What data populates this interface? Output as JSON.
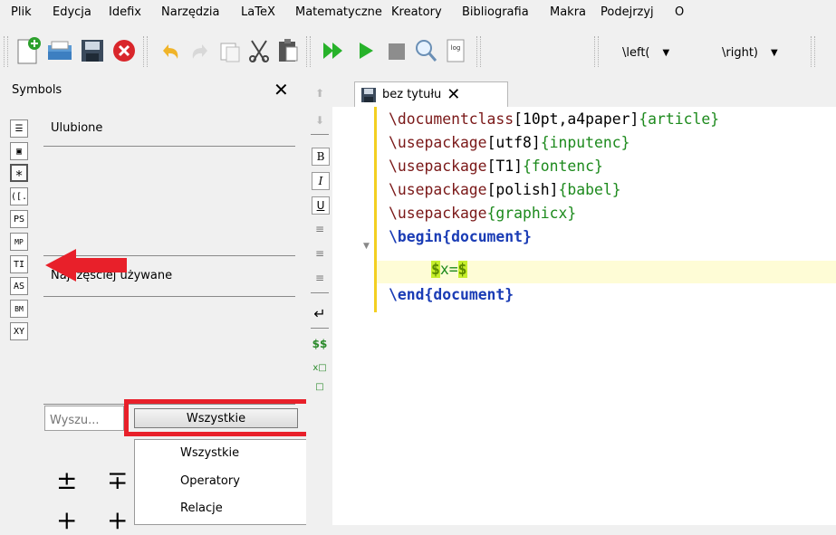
{
  "menubar": {
    "items": [
      "Plik",
      "Edycja",
      "Idefix",
      "Narzędzia",
      "LaTeX",
      "Matematyczne",
      "Kreatory",
      "Bibliografia",
      "Makra",
      "Podejrzyj",
      "O"
    ]
  },
  "toolbar": {
    "left_paren": "\\left(",
    "right_paren": "\\right)",
    "log_label": "log"
  },
  "symbols_panel": {
    "title": "Symbols",
    "close": "✕",
    "favorites_label": "Ulubione",
    "most_used_label": "Najczęściej używane",
    "side_icons": [
      "☰",
      "▣",
      "∗",
      "([.",
      "PS",
      "MP",
      "TI",
      "AS",
      "BM",
      "XY"
    ],
    "search_placeholder": "Wyszu...",
    "category_selected": "Wszystkie",
    "category_options": [
      "Wszystkie",
      "Operatory",
      "Relacje"
    ],
    "glyphs": [
      "±",
      "∓",
      "+",
      "+"
    ]
  },
  "format_strip": {
    "bold": "B",
    "italic": "I",
    "underline": "U",
    "dollars": "$$"
  },
  "editor": {
    "tab_title": "bez tytułu",
    "tab_close": "✕",
    "lines": [
      {
        "cmd": "\\documentclass",
        "opt": "[10pt,a4paper]",
        "arg": "{article}"
      },
      {
        "cmd": "\\usepackage",
        "opt": "[utf8]",
        "arg": "{inputenc}"
      },
      {
        "cmd": "\\usepackage",
        "opt": "[T1]",
        "arg": "{fontenc}"
      },
      {
        "cmd": "\\usepackage",
        "opt": "[polish]",
        "arg": "{babel}"
      },
      {
        "cmd": "\\usepackage",
        "opt": "",
        "arg": "{graphicx}"
      }
    ],
    "begin_cmd": "\\begin",
    "begin_arg": "{document}",
    "math_open": "$",
    "math_body": "x=",
    "math_close": "$",
    "end_cmd": "\\end",
    "end_arg": "{document}"
  },
  "colors": {
    "annotation_red": "#e8202a",
    "current_line": "#fefcd6",
    "change_bar": "#f3cf21"
  }
}
